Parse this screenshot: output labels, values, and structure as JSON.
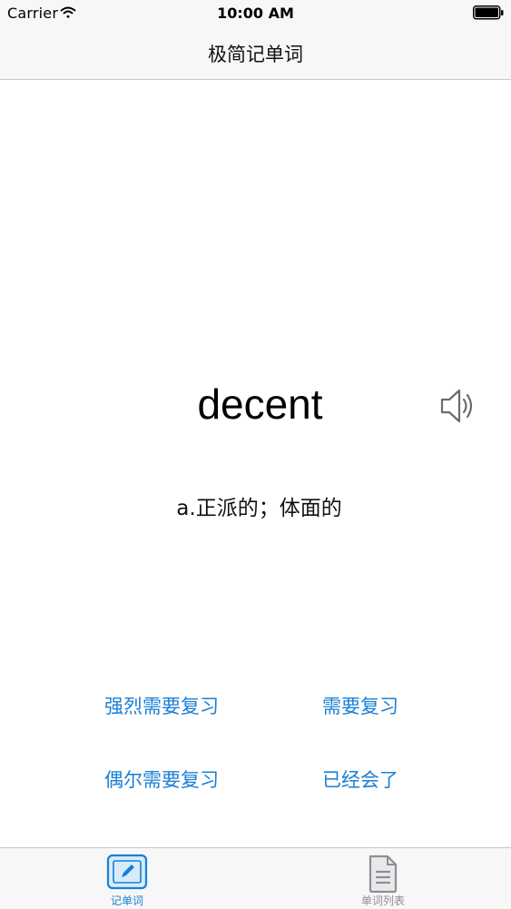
{
  "status_bar": {
    "carrier": "Carrier",
    "time": "10:00 AM",
    "icons": [
      "wifi-icon",
      "battery-icon"
    ]
  },
  "nav": {
    "title": "极简记单词"
  },
  "card": {
    "word": "decent",
    "definition": "a.正派的；体面的",
    "speaker_icon": "speaker-icon"
  },
  "review_buttons": {
    "strong": "强烈需要复习",
    "need": "需要复习",
    "occasional": "偶尔需要复习",
    "learned": "已经会了"
  },
  "tab_bar": {
    "tabs": [
      {
        "label": "记单词",
        "icon": "framed-pencil-icon",
        "selected": true
      },
      {
        "label": "单词列表",
        "icon": "document-icon",
        "selected": false
      }
    ]
  },
  "colors": {
    "accent": "#1a7fd4",
    "bar_background": "#f7f7f8",
    "inactive_tab": "#8e8e93"
  }
}
